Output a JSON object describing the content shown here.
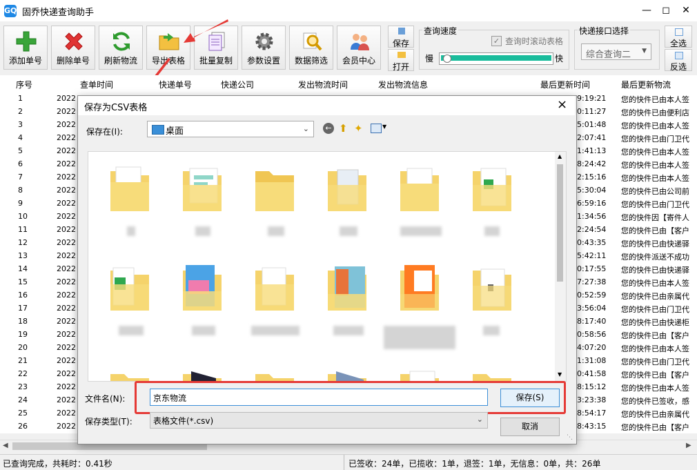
{
  "window": {
    "title": "固乔快递查询助手",
    "icon_text": "GQ"
  },
  "toolbar": {
    "buttons": [
      {
        "label": "添加单号",
        "icon": "plus-icon"
      },
      {
        "label": "删除单号",
        "icon": "x-icon"
      },
      {
        "label": "刷新物流",
        "icon": "refresh-icon"
      },
      {
        "label": "导出表格",
        "icon": "folder-export-icon"
      },
      {
        "label": "批量复制",
        "icon": "copy-icon"
      },
      {
        "label": "参数设置",
        "icon": "gear-icon"
      },
      {
        "label": "数据筛选",
        "icon": "magnifier-icon"
      },
      {
        "label": "会员中心",
        "icon": "users-icon"
      }
    ],
    "save_label": "保存",
    "open_label": "打开",
    "speed": {
      "group_label": "查询速度",
      "scroll_label": "查询时滚动表格",
      "slow": "慢",
      "fast": "快",
      "level": 0.05
    },
    "api": {
      "group_label": "快递接口选择",
      "selected": "综合查询二"
    },
    "select_all": "全选",
    "invert": "反选"
  },
  "table": {
    "headers": [
      "序号",
      "查单时间",
      "快递单号",
      "快递公司",
      "发出物流时间",
      "发出物流信息",
      "最后更新时间",
      "最后更新物流"
    ],
    "rows": [
      {
        "no": "1",
        "date": "2022",
        "time": "9:19:21",
        "last": "您的快件已由本人签"
      },
      {
        "no": "2",
        "date": "2022",
        "time": "0:11:27",
        "last": "您的快件已由便利店"
      },
      {
        "no": "3",
        "date": "2022",
        "time": "5:01:48",
        "last": "您的快件已由本人签"
      },
      {
        "no": "4",
        "date": "2022",
        "time": "2:07:41",
        "last": "您的快件已由门卫代"
      },
      {
        "no": "5",
        "date": "2022",
        "time": "1:41:13",
        "last": "您的快件已由本人签"
      },
      {
        "no": "6",
        "date": "2022",
        "time": "8:24:42",
        "last": "您的快件已由本人签"
      },
      {
        "no": "7",
        "date": "2022",
        "time": "2:15:16",
        "last": "您的快件已由本人签"
      },
      {
        "no": "8",
        "date": "2022",
        "time": "5:30:04",
        "last": "您的快件已由公司前"
      },
      {
        "no": "9",
        "date": "2022",
        "time": "6:59:16",
        "last": "您的快件已由门卫代"
      },
      {
        "no": "10",
        "date": "2022",
        "time": "1:34:56",
        "last": "您的快件因【寄件人"
      },
      {
        "no": "11",
        "date": "2022",
        "time": "2:24:54",
        "last": "您的快件已由【客户"
      },
      {
        "no": "12",
        "date": "2022",
        "time": "0:43:35",
        "last": "您的快件已由快递驿"
      },
      {
        "no": "13",
        "date": "2022",
        "time": "5:42:11",
        "last": "您的快件派送不成功"
      },
      {
        "no": "14",
        "date": "2022",
        "time": "0:17:55",
        "last": "您的快件已由快递驿"
      },
      {
        "no": "15",
        "date": "2022",
        "time": "7:27:38",
        "last": "您的快件已由本人签"
      },
      {
        "no": "16",
        "date": "2022",
        "time": "0:52:59",
        "last": "您的快件已由亲属代"
      },
      {
        "no": "17",
        "date": "2022",
        "time": "3:56:04",
        "last": "您的快件已由门卫代"
      },
      {
        "no": "18",
        "date": "2022",
        "time": "8:17:40",
        "last": "您的快件已由快递柜"
      },
      {
        "no": "19",
        "date": "2022",
        "time": "0:58:56",
        "last": "您的快件已由【客户"
      },
      {
        "no": "20",
        "date": "2022",
        "time": "4:07:20",
        "last": "您的快件已由本人签"
      },
      {
        "no": "21",
        "date": "2022",
        "time": "1:31:08",
        "last": "您的快件已由门卫代"
      },
      {
        "no": "22",
        "date": "2022",
        "time": "0:41:58",
        "last": "您的快件已由【客户"
      },
      {
        "no": "23",
        "date": "2022",
        "time": "8:15:12",
        "last": "您的快件已由本人签"
      },
      {
        "no": "24",
        "date": "2022",
        "time": "3:23:38",
        "last": "您的快件已签收，感"
      },
      {
        "no": "25",
        "date": "2022",
        "time": "8:54:17",
        "last": "您的快件已由亲属代"
      },
      {
        "no": "26",
        "date": "2022",
        "time": "8:43:15",
        "last": "您的快件已由【客户"
      }
    ]
  },
  "status": {
    "left": "已查询完成，共耗时：0.41秒",
    "right": "已签收：24单，已揽收：1单，退签：1单，无信息：0单，共：26单"
  },
  "dialog": {
    "title": "保存为CSV表格",
    "close": "×",
    "save_in_label": "保存在(I):",
    "location": "桌面",
    "filename_label": "文件名(N):",
    "filename": "京东物流",
    "filetype_label": "保存类型(T):",
    "filetype": "表格文件(*.csv)",
    "save_button": "保存(S)",
    "cancel_button": "取消",
    "colors": {
      "highlight": "#e53935",
      "accent": "#1e88e5"
    }
  }
}
